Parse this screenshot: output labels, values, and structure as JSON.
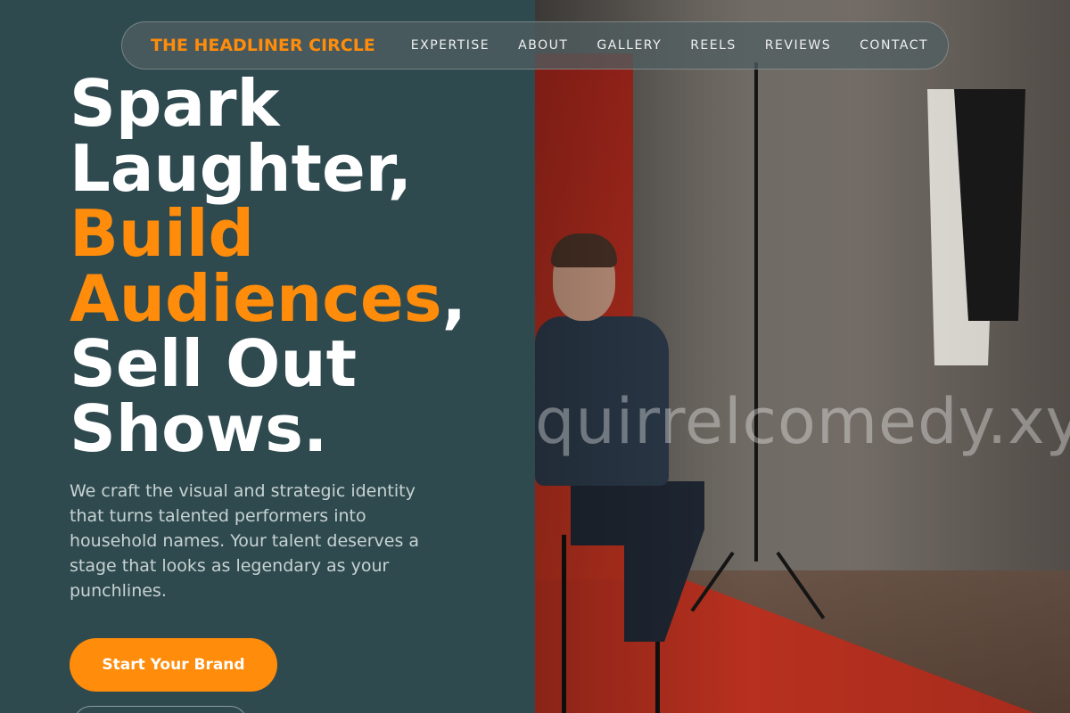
{
  "brand": "THE HEADLINER CIRCLE",
  "nav": [
    "EXPERTISE",
    "ABOUT",
    "GALLERY",
    "REELS",
    "REVIEWS",
    "CONTACT"
  ],
  "hero": {
    "line1": "Spark",
    "line2": "Laughter,",
    "line3": "Build",
    "line4_accent": "Audiences",
    "line4_rest": ",",
    "line5": "Sell Out",
    "line6": "Shows.",
    "description": "We craft the visual and strategic identity that turns talented performers into household names. Your talent deserves a stage that looks as legendary as your punchlines.",
    "cta_label": "Start Your Brand"
  },
  "watermark": "quirrelcomedy.xy",
  "colors": {
    "accent": "#ff8c0a",
    "panel": "#2f4a4f"
  }
}
